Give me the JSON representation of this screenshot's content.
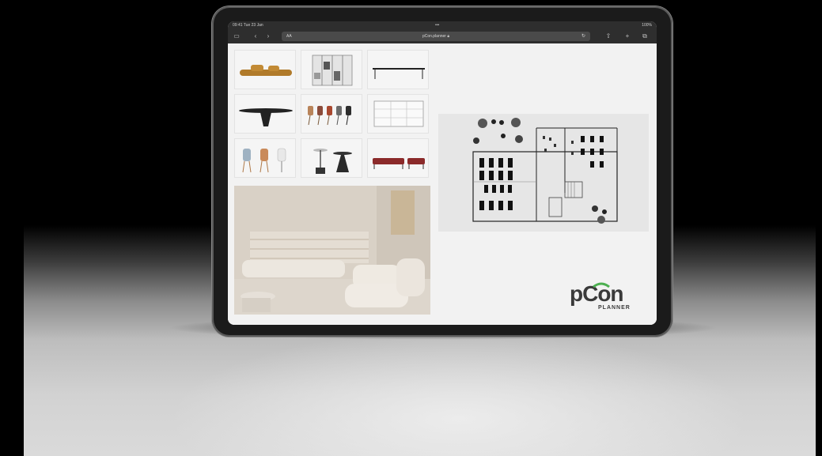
{
  "statusbar": {
    "time": "09:41  Tue 23 Jan",
    "dots": "•••",
    "battery": "100%"
  },
  "browser": {
    "url": "pCon.planner",
    "aa": "AA",
    "reload": "↻"
  },
  "brand": {
    "logo_main": "pCon",
    "logo_sub": "PLANNER",
    "accent": "#4caf50",
    "ink": "#3a3a3a"
  },
  "catalog": {
    "tiles": [
      "sofa-tile",
      "shelving-tile",
      "table-tile",
      "conference-table-tile",
      "chairs-tile",
      "storage-tile",
      "dining-chairs-tile",
      "bistro-tables-tile",
      "lounge-sofa-tile"
    ]
  },
  "icons": [
    "sidebar-icon",
    "back-icon",
    "forward-icon",
    "share-icon",
    "add-tab-icon",
    "tabs-icon",
    "lock-icon",
    "reload-icon"
  ]
}
